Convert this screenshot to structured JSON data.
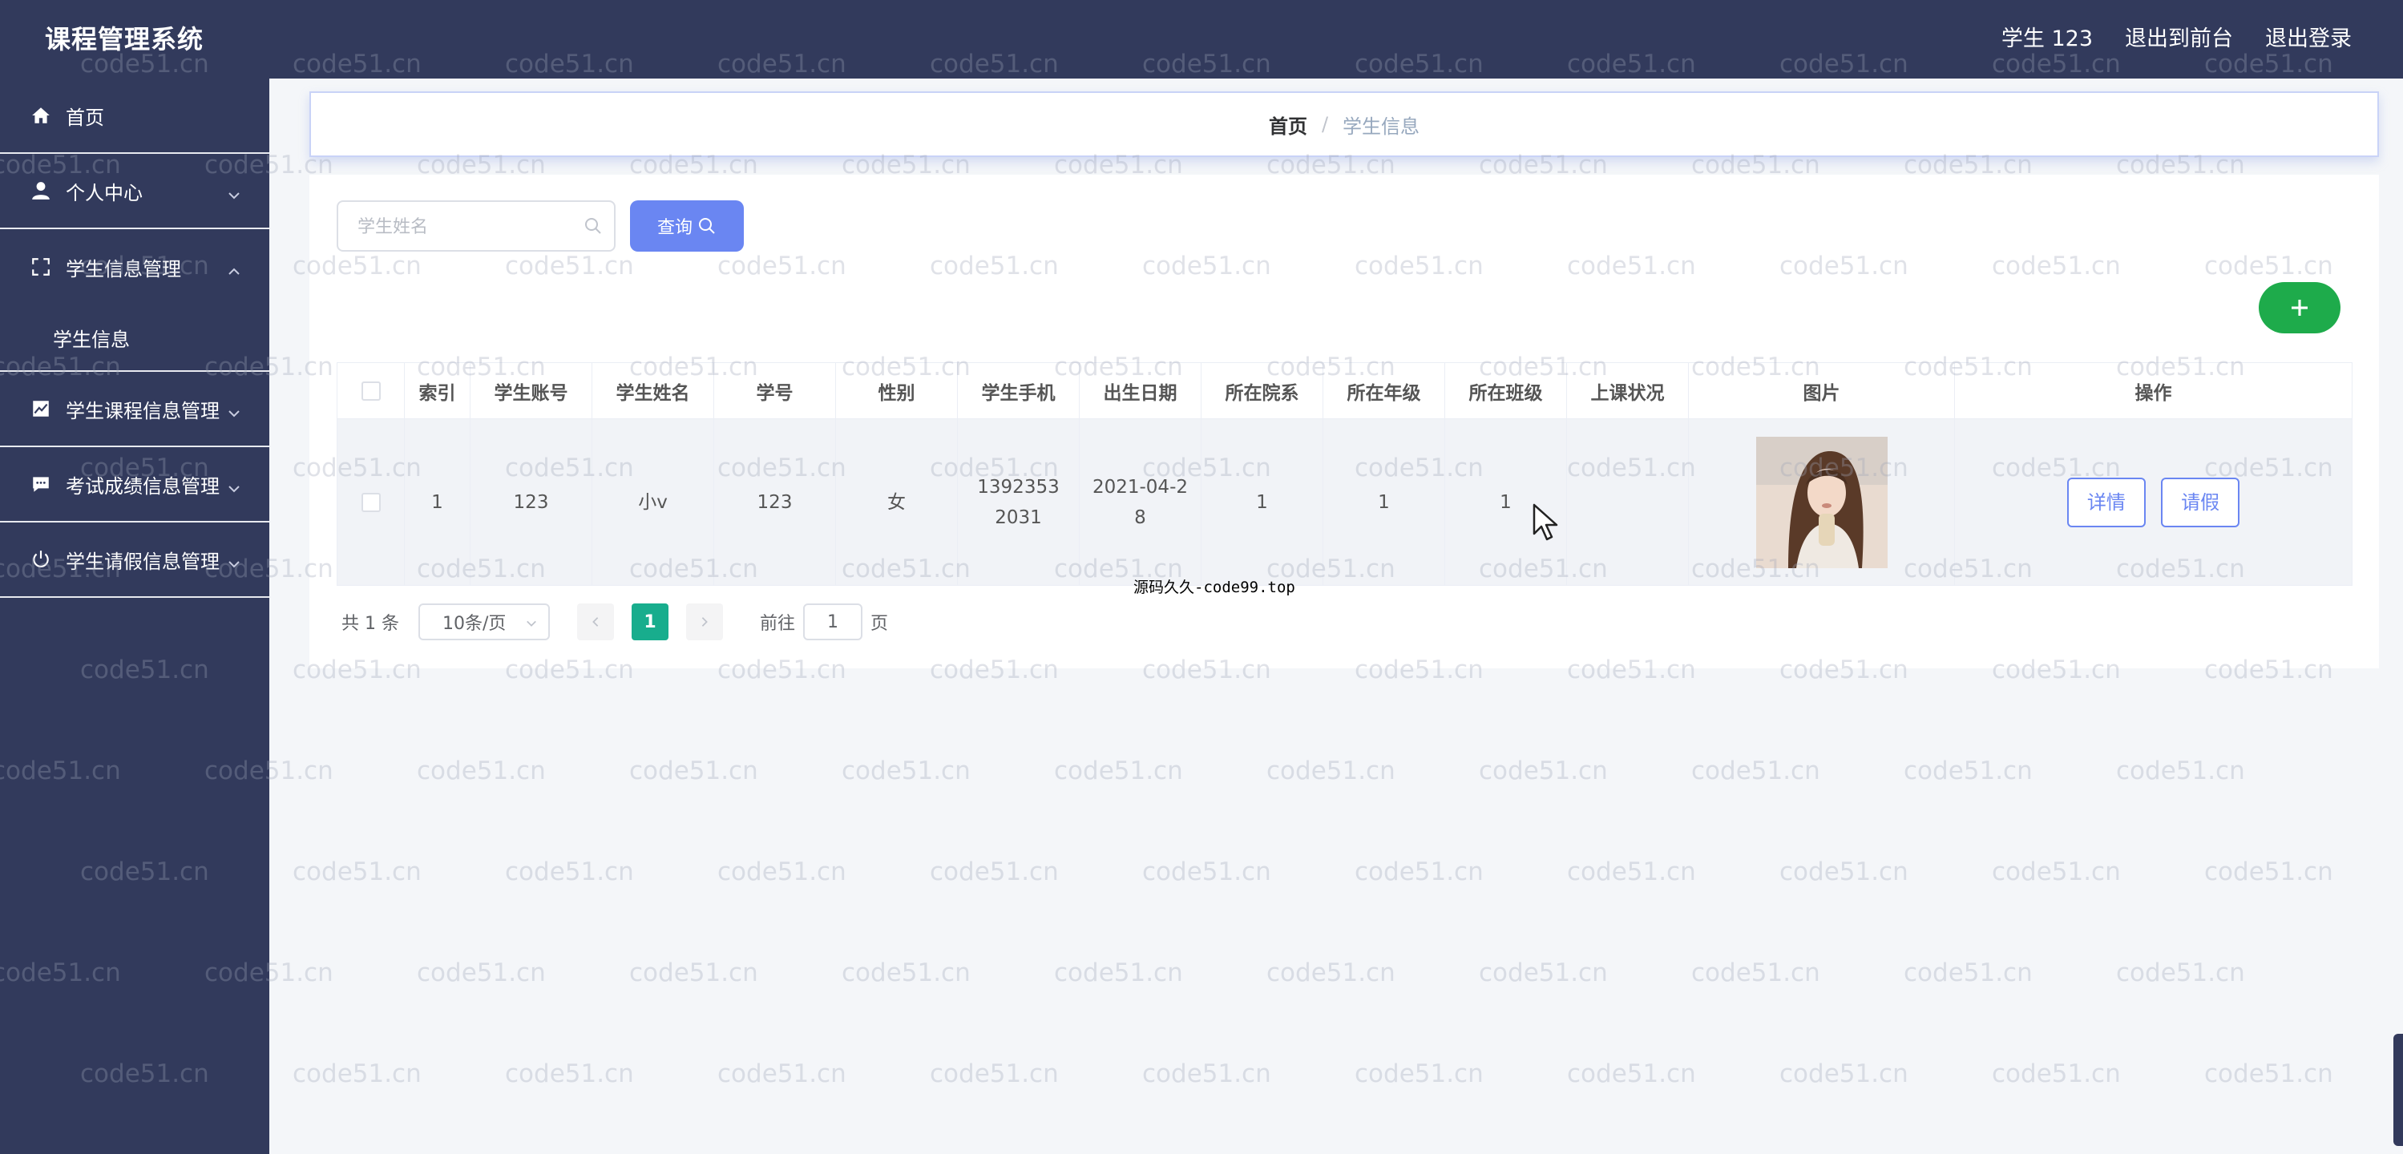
{
  "header": {
    "app_title": "课程管理系统",
    "user_label": "学生 123",
    "to_front_label": "退出到前台",
    "logout_label": "退出登录"
  },
  "sidebar": {
    "items": [
      {
        "label": "首页",
        "icon": "home-icon"
      },
      {
        "label": "个人中心",
        "icon": "user-icon"
      },
      {
        "label": "学生信息管理",
        "icon": "fullscreen-icon",
        "expanded": true
      },
      {
        "label": "学生信息",
        "submenu": true
      },
      {
        "label": "学生课程信息管理",
        "icon": "chart-icon"
      },
      {
        "label": "考试成绩信息管理",
        "icon": "chat-icon"
      },
      {
        "label": "学生请假信息管理",
        "icon": "power-icon"
      }
    ]
  },
  "breadcrumb": {
    "home": "首页",
    "separator": "/",
    "current": "学生信息"
  },
  "search": {
    "placeholder": "学生姓名",
    "query_label": "查询"
  },
  "table": {
    "columns": [
      "索引",
      "学生账号",
      "学生姓名",
      "学号",
      "性别",
      "学生手机",
      "出生日期",
      "所在院系",
      "所在年级",
      "所在班级",
      "上课状况",
      "图片",
      "操作"
    ],
    "rows": [
      {
        "index": "1",
        "account": "123",
        "name": "小v",
        "student_no": "123",
        "gender": "女",
        "phone": "13923532031",
        "birthday": "2021-04-28",
        "department": "1",
        "grade": "1",
        "class": "1",
        "attendance": "",
        "detail_label": "详情",
        "leave_label": "请假"
      }
    ]
  },
  "pagination": {
    "total": "共 1 条",
    "page_size": "10条/页",
    "current_page": "1",
    "goto_prefix": "前往",
    "goto_value": "1",
    "goto_suffix": "页"
  },
  "source_note": "源码久久-code99.top",
  "watermark": "code51.cn",
  "colors": {
    "sidebar_bg": "#323a5c",
    "primary": "#6a86f2",
    "add_green": "#1eab4b",
    "page_active": "#18ad8d"
  }
}
